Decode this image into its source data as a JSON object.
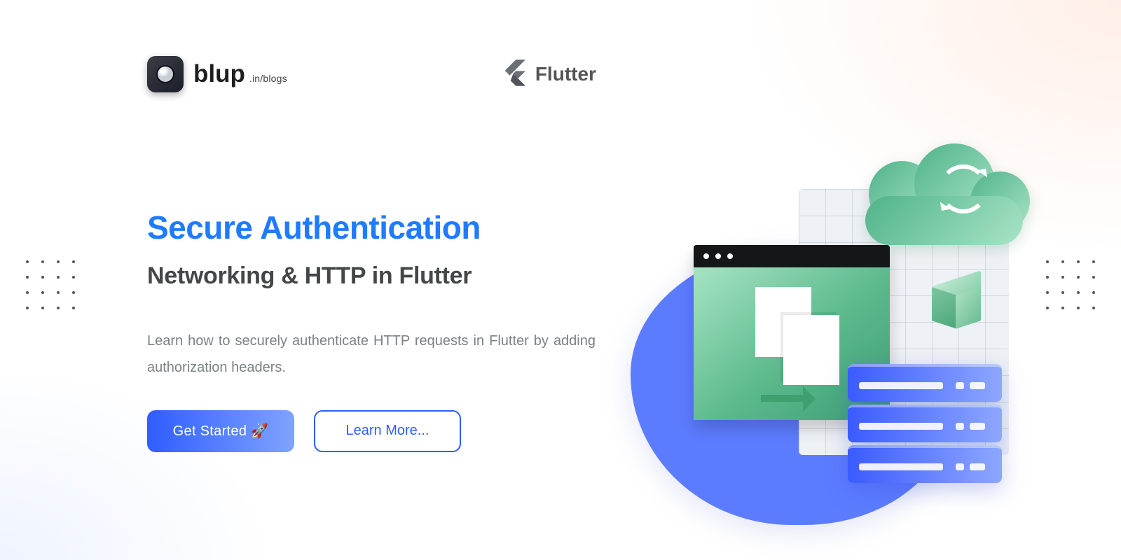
{
  "brand": {
    "name": "blup",
    "suffix": ".in/blogs"
  },
  "tech": {
    "name": "Flutter"
  },
  "content": {
    "headline": "Secure Authentication",
    "subhead": "Networking & HTTP in Flutter",
    "paragraph": "Learn how to securely authenticate HTTP requests in Flutter by adding authorization headers."
  },
  "actions": {
    "primary": "Get Started 🚀",
    "secondary": "Learn More..."
  }
}
